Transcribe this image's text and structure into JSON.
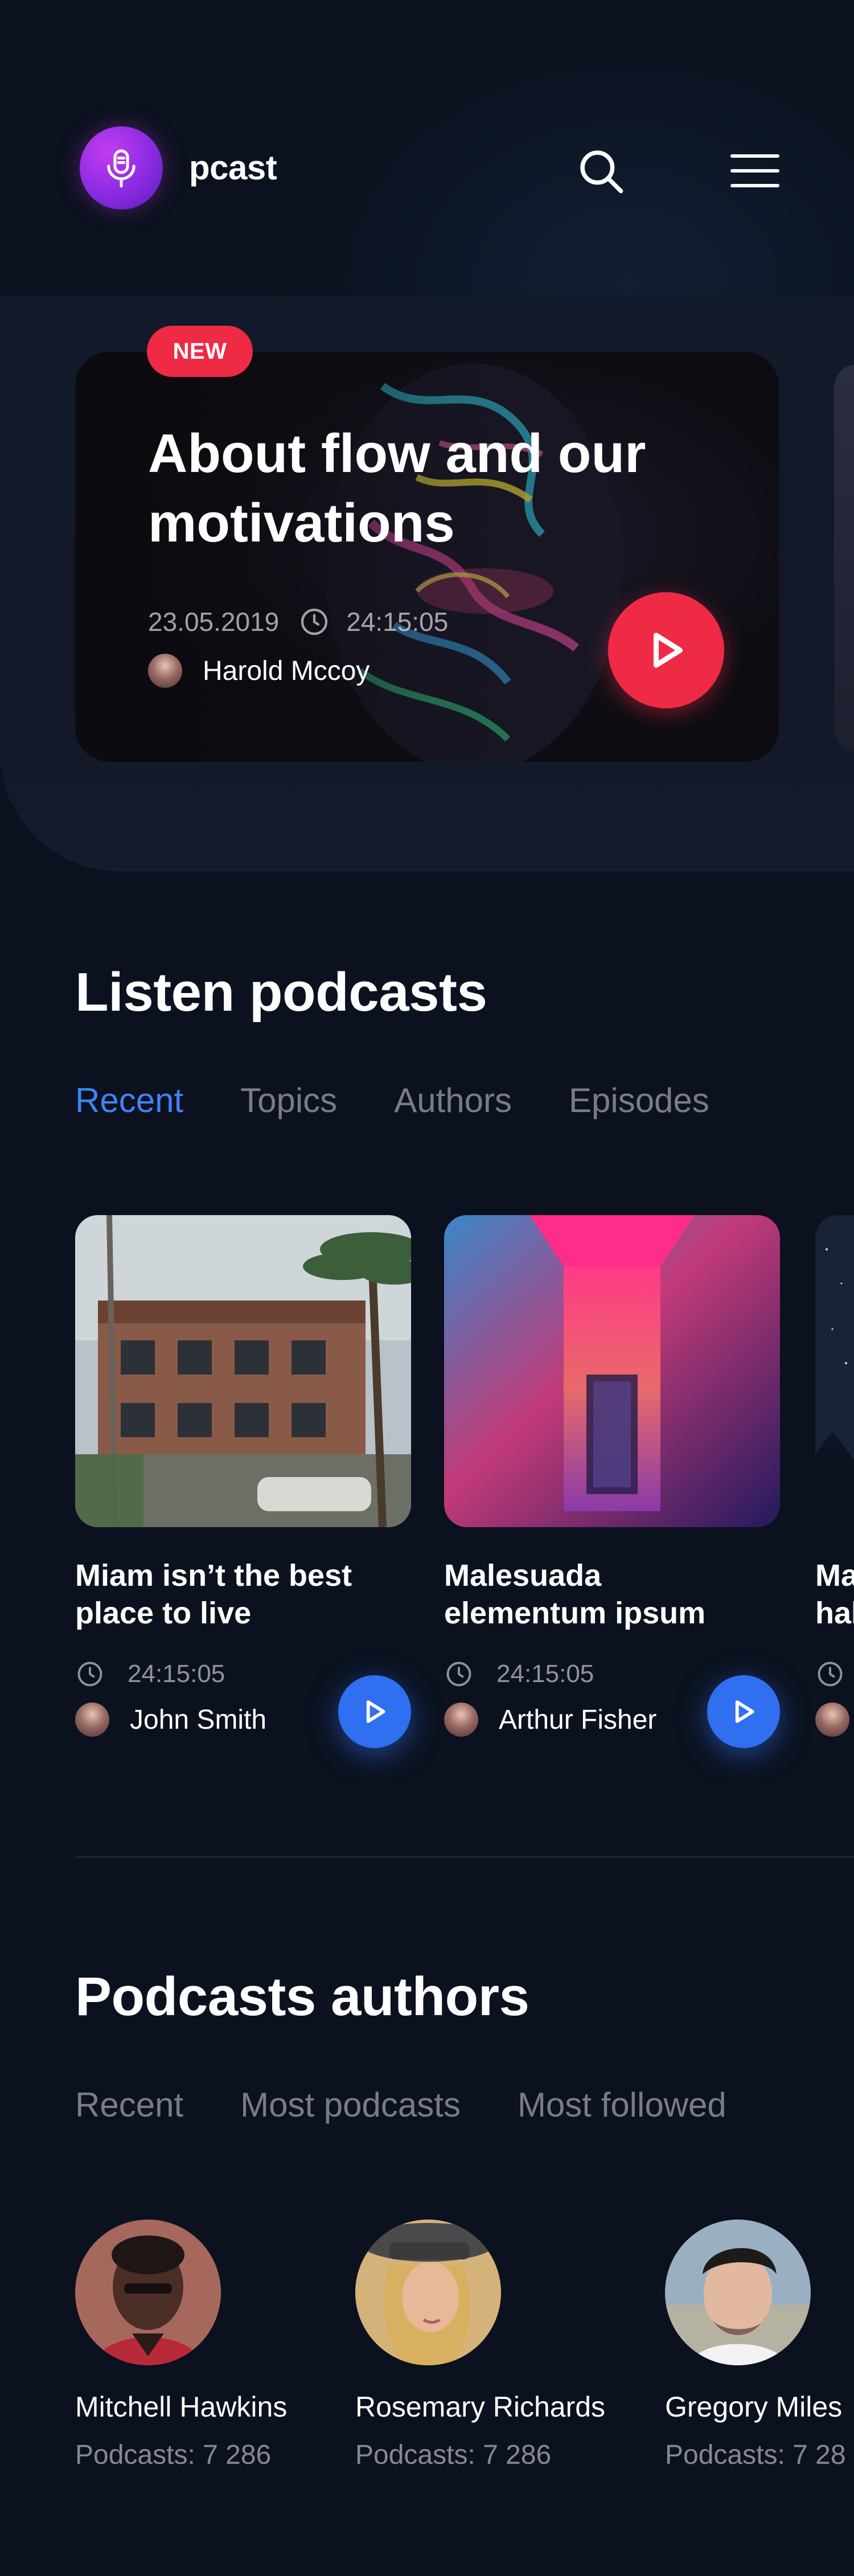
{
  "app": {
    "brand": "pcast",
    "icons": {
      "logo": "microphone-icon",
      "search": "search-icon",
      "menu": "hamburger-menu-icon"
    }
  },
  "hero": {
    "badge": "NEW",
    "title": "About flow and our motivations",
    "date": "23.05.2019",
    "duration": "24:15:05",
    "author": "Harold Mccoy",
    "accent": "#ef2a45"
  },
  "listen": {
    "title": "Listen podcasts",
    "tabs": [
      {
        "label": "Recent",
        "active": true
      },
      {
        "label": "Topics",
        "active": false
      },
      {
        "label": "Authors",
        "active": false
      },
      {
        "label": "Episodes",
        "active": false
      }
    ],
    "accent": "#3f82f5",
    "cards": [
      {
        "title_line1": "Miam isn’t the best",
        "title_line2": "place to live",
        "duration": "24:15:05",
        "author": "John Smith"
      },
      {
        "title_line1": "Malesuada",
        "title_line2": "elementum ipsum",
        "duration": "24:15:05",
        "author": "Arthur Fisher"
      },
      {
        "title_line1": "Ma",
        "title_line2": "hal",
        "duration": "",
        "author": ""
      }
    ]
  },
  "authors": {
    "title": "Podcasts authors",
    "tabs": [
      {
        "label": "Recent"
      },
      {
        "label": "Most podcasts"
      },
      {
        "label": "Most followed"
      }
    ],
    "items": [
      {
        "name": "Mitchell Hawkins",
        "count": "Podcasts: 7 286"
      },
      {
        "name": "Rosemary Richards",
        "count": "Podcasts: 7 286"
      },
      {
        "name": "Gregory Miles",
        "count": "Podcasts: 7 28"
      }
    ]
  }
}
